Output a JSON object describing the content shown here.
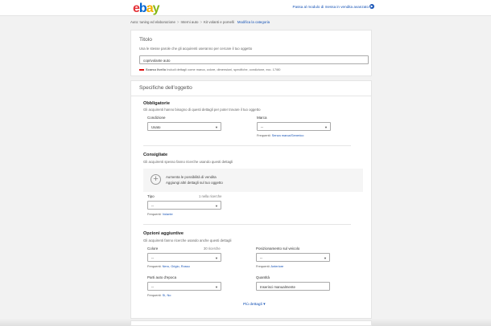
{
  "header": {
    "logo_letters": [
      "e",
      "b",
      "a",
      "y"
    ],
    "switch_link": "Passa al modulo di messa in vendita avanzato",
    "colors": {
      "e": "#e53238",
      "b": "#0064d2",
      "a": "#f5af02",
      "y": "#86b817",
      "link": "#1552b5"
    }
  },
  "breadcrumb": {
    "items": [
      "Auto: tuning ed elaborazione",
      "Interni auto",
      "Kit volanti e pomelli"
    ],
    "edit_link": "Modifica la categoria"
  },
  "title_section": {
    "heading": "Titolo",
    "hint": "Usa le stesse parole che gli acquirenti useranno per cercare il tuo oggetto",
    "value": "coprivolante auto",
    "strength": "Scarso livello",
    "strength_hint": "Includi dettagli come marca, colore, dimensioni, specifiche, condizione, ecc. 17/80"
  },
  "specifics": {
    "heading": "Specifiche dell'oggetto",
    "required": {
      "title": "Obbligatorie",
      "hint": "Gli acquirenti hanno bisogno di questi dettagli per poter trovare il tuo oggetto",
      "condition": {
        "label": "Condizione",
        "value": "Usato"
      },
      "brand": {
        "label": "Marca",
        "value": "--",
        "freq_prefix": "Frequenti:",
        "freq_value": "Senza marca/Generico"
      }
    },
    "recommended": {
      "title": "Consigliate",
      "hint": "Gli acquirenti spesso fanno ricerche usando questi dettagli",
      "tip_line1": "Aumenta le possibilità di vendita",
      "tip_line2": "Aggiungi altri dettagli sul tuo oggetto",
      "type": {
        "label": "Tipo",
        "counter": "1 nella ricerche",
        "value": "--",
        "freq_prefix": "Frequenti:",
        "freq_value": "Volante"
      }
    },
    "additional": {
      "title": "Opzioni aggiuntive",
      "hint": "Gli acquirenti fanno ricerche usando anche questi dettagli",
      "color": {
        "label": "Colore",
        "counter": "30 ricerche",
        "value": "--",
        "freq_prefix": "Frequenti:",
        "freq_value": "Nero, Grigio, Rosso"
      },
      "placement": {
        "label": "Posizionamento sul veicolo",
        "value": "--",
        "freq_prefix": "Frequenti:",
        "freq_value": "Anteriore"
      },
      "spare_part": {
        "label": "Parti auto d'epoca",
        "value": "--",
        "freq_prefix": "Frequenti:",
        "freq_value": "Sì, No"
      },
      "quantity": {
        "label": "Quantità",
        "value": "Inserisci manualmente"
      }
    },
    "more_link": "Più dettagli"
  }
}
